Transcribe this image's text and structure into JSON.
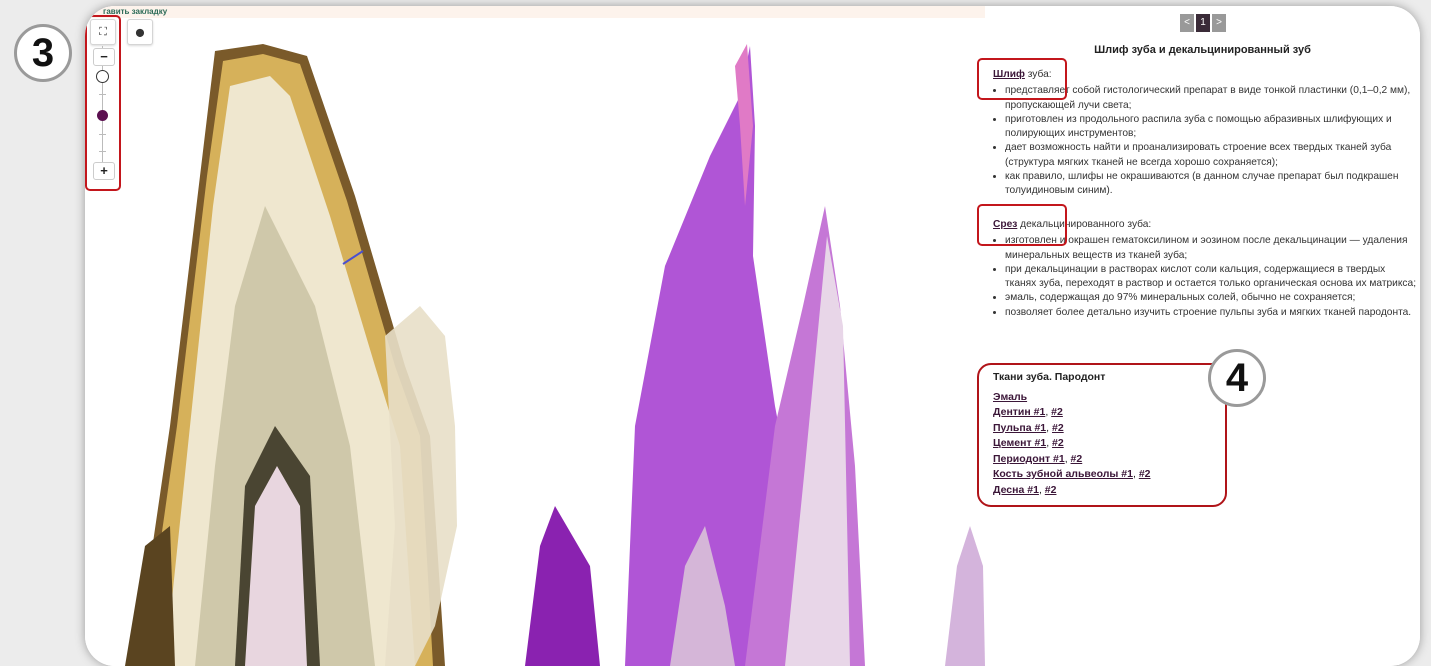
{
  "viewer": {
    "bookmark_label": "гавить закладку",
    "fullscreen_icon": "⛶",
    "pin_icon": "⬤",
    "zoom_out": "−",
    "zoom_in": "+",
    "colors": {
      "enamel_tooth": "#c9a34a",
      "stained_tooth": "#a24cc8",
      "handle": "#5b1050"
    }
  },
  "markers": {
    "m3": "3",
    "m4": "4"
  },
  "pager": {
    "prev": "<",
    "current": "1",
    "next": ">"
  },
  "panel": {
    "title": "Шлиф зуба и декальцинированный зуб",
    "shlif": {
      "term": "Шлиф",
      "rest": " зуба:",
      "items": [
        "представляет собой гистологический препарат в виде тонкой пластинки (0,1–0,2 мм), пропускающей лучи света;",
        "приготовлен из продольного распила зуба с помощью абразивных шлифующих и полирующих инструментов;",
        "дает возможность найти и проанализировать строение всех твердых тканей зуба (структура мягких тканей не всегда хорошо сохраняется);",
        "как правило, шлифы не окрашиваются (в данном случае препарат был подкрашен толуидиновым синим)."
      ]
    },
    "srez": {
      "term": "Срез",
      "rest": " декальцинированного зуба:",
      "items": [
        "изготовлен и окрашен гематоксилином и эозином после декальцинации — удаления минеральных веществ из тканей зуба;",
        "при декальцинации в растворах кислот соли кальция, содержащиеся в твердых тканях зуба, переходят в раствор и остается только органическая основа их матрикса;",
        "эмаль, содержащая до 97% минеральных солей, обычно не сохраняется;",
        "позволяет более детально изучить строение пульпы зуба и мягких тканей пародонта."
      ]
    },
    "tissues": {
      "heading": "Ткани зуба. Пародонт",
      "links": [
        {
          "name": "Эмаль",
          "n1": "",
          "n2": ""
        },
        {
          "name": "Дентин #1",
          "n1": ", ",
          "n2": "#2"
        },
        {
          "name": "Пульпа #1",
          "n1": ", ",
          "n2": "#2"
        },
        {
          "name": "Цемент #1",
          "n1": ", ",
          "n2": "#2"
        },
        {
          "name": "Периодонт #1",
          "n1": ", ",
          "n2": "#2"
        },
        {
          "name": "Кость зубной альвеолы #1",
          "n1": ", ",
          "n2": "#2"
        },
        {
          "name": "Десна #1",
          "n1": ", ",
          "n2": "#2"
        }
      ]
    }
  }
}
